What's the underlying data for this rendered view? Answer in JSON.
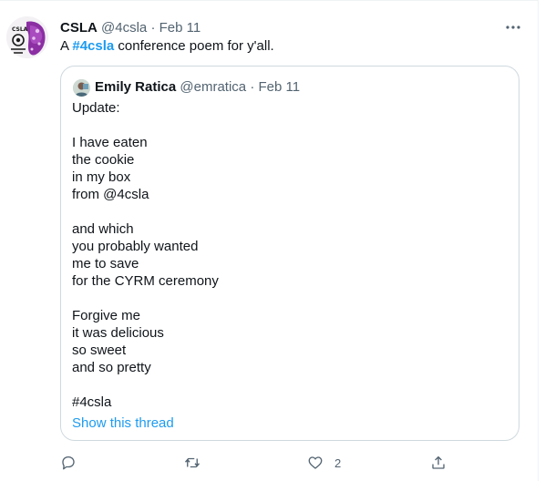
{
  "tweet": {
    "author_name": "CSLA",
    "handle": "@4csla",
    "separator": "·",
    "date": "Feb 11",
    "text_prefix": "A ",
    "hashtag": "#4csla",
    "text_suffix": " conference poem for y'all."
  },
  "quoted": {
    "author_name": "Emily Ratica",
    "handle": "@emratica",
    "separator": "·",
    "date": "Feb 11",
    "lines": [
      "Update:",
      "",
      "I have eaten",
      "the cookie",
      "in my box",
      "from @4csla",
      "",
      "and which",
      "you probably wanted",
      "me to save",
      "for the CYRM ceremony",
      "",
      "Forgive me",
      "it was delicious",
      "so sweet",
      "and so pretty",
      "",
      "#4csla"
    ],
    "show_thread": "Show this thread"
  },
  "actions": {
    "reply_icon": "reply-icon",
    "retweet_icon": "retweet-icon",
    "like_icon": "heart-icon",
    "like_count": "2",
    "share_icon": "share-icon"
  },
  "colors": {
    "link": "#1d9bf0",
    "muted": "#536471",
    "border": "#cfd9de"
  }
}
